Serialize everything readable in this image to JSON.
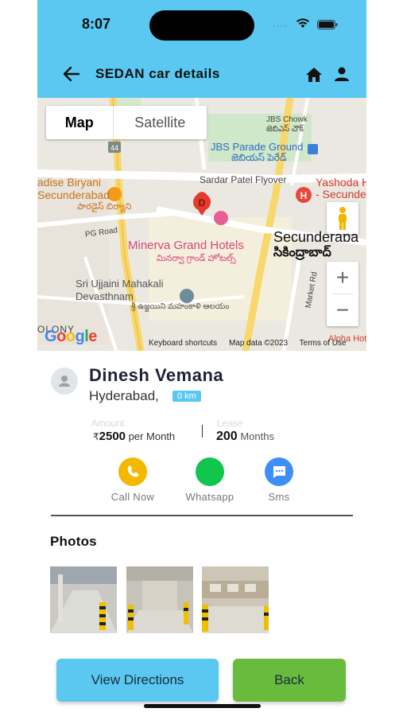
{
  "status_bar": {
    "time": "8:07",
    "dots": "····"
  },
  "header": {
    "title": "SEDAN car details",
    "bg_color": "#5ac8f0"
  },
  "map": {
    "type_tabs": [
      "Map",
      "Satellite"
    ],
    "selected_type": "Map",
    "labels": {
      "jbs_chowk": "JBS Chowk",
      "jbs_chowk_te": "జెబిఎస్ చౌక్",
      "jbs_parade": "JBS Parade Ground",
      "jbs_parade_te": "జెబియస్ పెరేడ్",
      "sardar": "Sardar Patel Flyover",
      "paradise1": "adise Biryani",
      "paradise2": "Secunderabad",
      "paradise_te": "పారడైస్ బిర్యాని",
      "yashoda1": "Yashoda H",
      "yashoda2": "- Secunde",
      "pg_road": "PG Road",
      "minerva": "Minerva Grand Hotels",
      "minerva_te": "మినర్వా గ్రాండ్ హోటల్స్",
      "secunderabad": "Secunderaba",
      "secunderabad_te": "సికింద్రాబాద్",
      "ujjaini1": "Sri Ujjaini Mahakali",
      "ujjaini2": "Devasthnam",
      "ujjaini_te": "శ్రీ ఉజ్జయిని మహంకాళి ఆలయం",
      "market_rd": "Market Rd",
      "colony": "OLONY",
      "alpha": "Alpha Hotel",
      "route_44": "44",
      "marker_letter": "D"
    },
    "zoom_in": "+",
    "zoom_out": "−",
    "footer": {
      "shortcuts": "Keyboard shortcuts",
      "data": "Map data ©2023",
      "terms": "Terms of Use"
    },
    "logo": "Google"
  },
  "profile": {
    "name": "Dinesh Vemana",
    "city": "Hyderabad,",
    "distance": "0 km",
    "amount_label": "Amount",
    "currency": "₹",
    "amount": "2500",
    "amount_unit": " per Month",
    "lease_label": "Lease",
    "lease": "200",
    "lease_unit": " Months"
  },
  "actions": [
    {
      "label": "Call Now",
      "color": "#f5b800"
    },
    {
      "label": "Whatsapp",
      "color": "#12c54c"
    },
    {
      "label": "Sms",
      "color": "#3d8ff5"
    }
  ],
  "photos": {
    "title": "Photos",
    "count": 3
  },
  "buttons": {
    "directions": "View Directions",
    "back": "Back"
  }
}
